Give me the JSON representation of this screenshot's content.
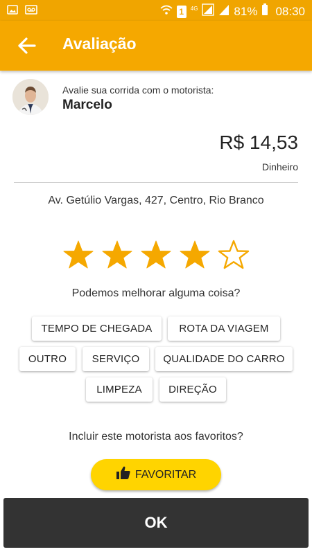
{
  "status_bar": {
    "battery": "81%",
    "time": "08:30",
    "network": "4G",
    "sim_indicator": "1",
    "icons": [
      "gallery-icon",
      "voicemail-icon",
      "wifi-icon",
      "sim-icon",
      "signal-icon",
      "signal-icon",
      "battery-icon"
    ]
  },
  "app_bar": {
    "title": "Avaliação",
    "back_icon": "arrow-back-icon"
  },
  "driver": {
    "caption": "Avalie sua corrida com o motorista:",
    "name": "Marcelo",
    "avatar_icon": "driver-avatar"
  },
  "trip": {
    "price": "R$ 14,53",
    "payment_method": "Dinheiro",
    "address": "Av. Getúlio Vargas, 427, Centro, Rio Branco"
  },
  "rating": {
    "value": 4,
    "max": 5,
    "color": "#f5a800"
  },
  "feedback": {
    "question": "Podemos melhorar alguma coisa?",
    "options": [
      "TEMPO DE CHEGADA",
      "ROTA DA VIAGEM",
      "OUTRO",
      "SERVIÇO",
      "QUALIDADE DO CARRO",
      "LIMPEZA",
      "DIREÇÃO"
    ]
  },
  "favorite": {
    "question": "Incluir este motorista aos favoritos?",
    "button_label": "FAVORITAR",
    "button_icon": "thumbs-up-icon",
    "button_color": "#ffd400"
  },
  "ok_button": {
    "label": "OK",
    "color": "#333333"
  }
}
